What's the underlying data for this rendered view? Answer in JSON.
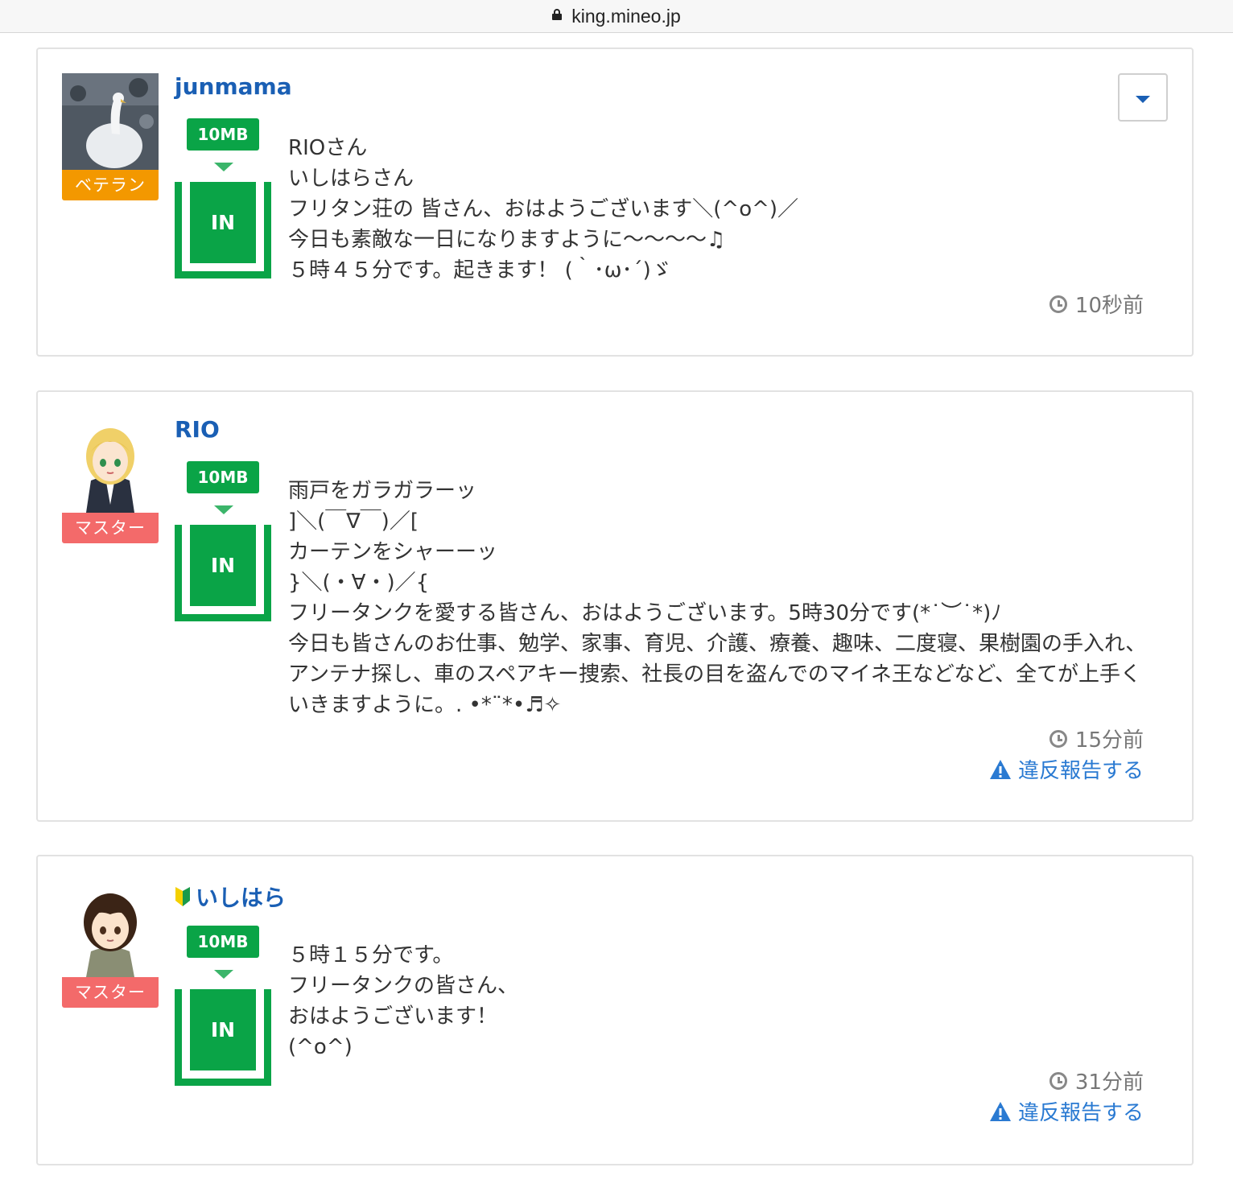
{
  "browser": {
    "url": "king.mineo.jp"
  },
  "posts": [
    {
      "username": "junmama",
      "rank": "ベテラン",
      "data_badge": "10MB",
      "in_label": "IN",
      "body": "RIOさん\nいしはらさん\nフリタン荘の 皆さん、おはようございます＼(^o^)／\n今日も素敵な一日になりますように〜〜〜〜♫\n５時４５分です。起きます！ (｀･ω･´)ゞ",
      "time": "10秒前"
    },
    {
      "username": "RIO",
      "rank": "マスター",
      "data_badge": "10MB",
      "in_label": "IN",
      "body": "雨戸をガラガラーッ\n]＼(￣∇￣)／[\nカーテンをシャーーッ\n}＼(・∀・)／{\nフリータンクを愛する皆さん、おはようございます。5時30分です(*˙︶˙*)ﾉ\n今日も皆さんのお仕事、勉学、家事、育児、介護、療養、趣味、二度寝、果樹園の手入れ、アンテナ探し、車のスペアキー捜索、社長の目を盗んでのマイネ王などなど、全てが上手くいきますように。. •*¨*•♬✧",
      "time": "15分前",
      "report": "違反報告する"
    },
    {
      "username": "いしはら",
      "rank": "マスター",
      "data_badge": "10MB",
      "in_label": "IN",
      "body": "５時１５分です。\nフリータンクの皆さん、\nおはようございます！\n(^o^)",
      "time": "31分前",
      "report": "違反報告する"
    }
  ],
  "colors": {
    "accent_blue": "#1a5fb4",
    "link_blue": "#2a7ad2",
    "green": "#0aa447",
    "veteran_orange": "#f39800",
    "master_red": "#f36a6a"
  },
  "icons": [
    "lock-icon",
    "dropdown-caret-icon",
    "clock-icon",
    "warning-icon",
    "beginner-mark-icon"
  ]
}
